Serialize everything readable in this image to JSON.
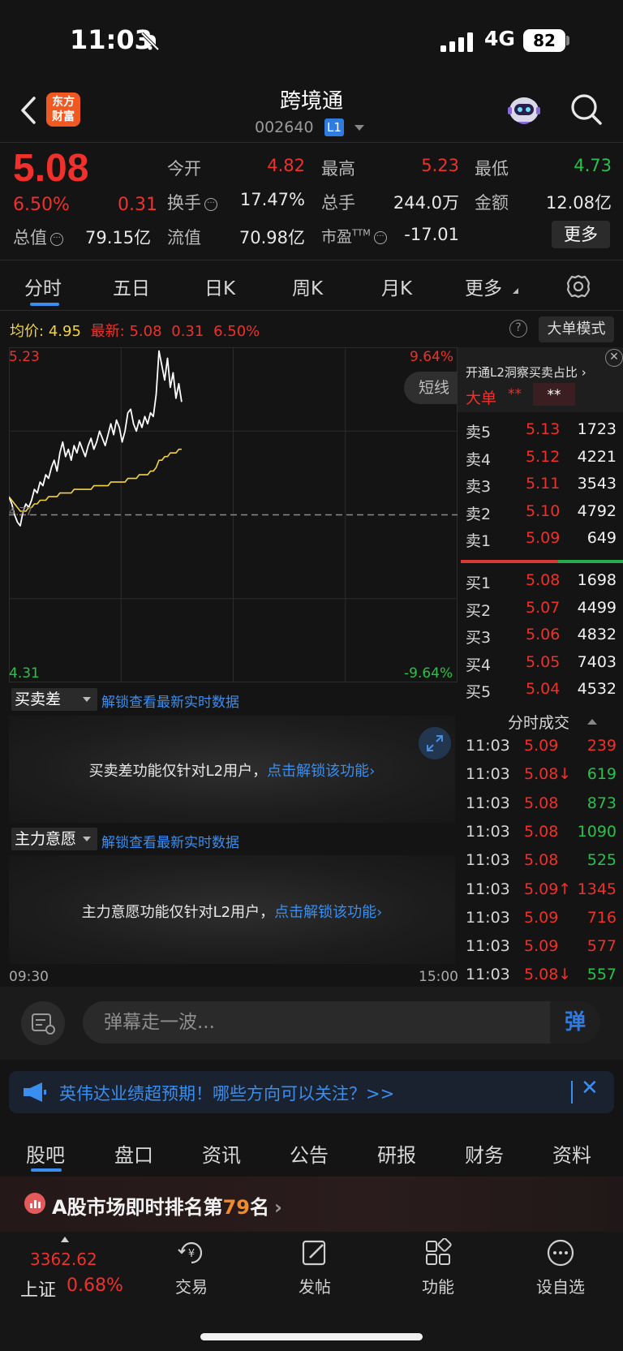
{
  "status_bar": {
    "time": "11:03",
    "network": "4G",
    "battery": "82"
  },
  "header": {
    "logo_text": "东方\n财富",
    "stock_name": "跨境通",
    "stock_code": "002640",
    "level": "L1"
  },
  "quote": {
    "price": "5.08",
    "change_pct": "6.50%",
    "change": "0.31",
    "open_label": "今开",
    "open": "4.82",
    "high_label": "最高",
    "high": "5.23",
    "low_label": "最低",
    "low": "4.73",
    "turnover_label": "换手",
    "turnover": "17.47%",
    "volume_label": "总手",
    "volume": "244.0万",
    "amount_label": "金额",
    "amount": "12.08亿",
    "mcap_label": "总值",
    "mcap": "79.15亿",
    "float_label": "流值",
    "float_mcap": "70.98亿",
    "pe_label": "市盈",
    "pe_sup": "TTM",
    "pe": "-17.01",
    "more_label": "更多"
  },
  "chart_tabs": [
    "分时",
    "五日",
    "日K",
    "周K",
    "月K",
    "更多"
  ],
  "legend": {
    "avg_label": "均价:",
    "avg": "4.95",
    "latest_label": "最新:",
    "latest": "5.08",
    "chg": "0.31",
    "pct": "6.50%",
    "help": "?",
    "big_order_mode": "大单模式"
  },
  "chart_data": {
    "type": "line",
    "y_axis_left": {
      "top": "5.23",
      "bottom": "4.31"
    },
    "y_axis_right": {
      "top": "9.64%",
      "bottom": "-9.64%"
    },
    "prev_close_label": "4.77",
    "ylim": [
      4.31,
      5.23
    ],
    "x_labels": [
      "09:30",
      "15:00"
    ],
    "series": [
      {
        "values": [
          4.82,
          4.8,
          4.77,
          4.75,
          4.74,
          4.78,
          4.8,
          4.79,
          4.81,
          4.84,
          4.83,
          4.86,
          4.85,
          4.88,
          4.87,
          4.9,
          4.92,
          4.89,
          4.94,
          4.97,
          4.93,
          4.95,
          4.92,
          4.96,
          4.94,
          4.97,
          4.95,
          4.93,
          4.96,
          4.98,
          4.95,
          4.97,
          5.0,
          4.98,
          4.96,
          4.99,
          5.02,
          4.99,
          5.03,
          5.01,
          4.97,
          5.0,
          5.05,
          5.06,
          5.02,
          5.0,
          5.03,
          5.01,
          5.04,
          5.02,
          5.05,
          5.04,
          5.1,
          5.22,
          5.18,
          5.14,
          5.2,
          5.12,
          5.16,
          5.09,
          5.13,
          5.08
        ]
      },
      {
        "values": [
          4.82,
          4.81,
          4.8,
          4.79,
          4.78,
          4.78,
          4.78,
          4.79,
          4.79,
          4.8,
          4.8,
          4.81,
          4.81,
          4.81,
          4.82,
          4.82,
          4.82,
          4.82,
          4.83,
          4.83,
          4.83,
          4.83,
          4.83,
          4.84,
          4.84,
          4.84,
          4.84,
          4.84,
          4.84,
          4.84,
          4.85,
          4.85,
          4.85,
          4.85,
          4.85,
          4.85,
          4.86,
          4.86,
          4.86,
          4.86,
          4.86,
          4.86,
          4.87,
          4.87,
          4.87,
          4.87,
          4.88,
          4.88,
          4.88,
          4.88,
          4.89,
          4.89,
          4.9,
          4.92,
          4.92,
          4.93,
          4.93,
          4.94,
          4.94,
          4.94,
          4.95,
          4.95
        ]
      }
    ],
    "colors": {
      "price": "#ffffff",
      "avg": "#f2d440"
    }
  },
  "short_line_btn": "短线",
  "indicators": [
    {
      "name": "买卖差",
      "link": "解锁查看最新实时数据",
      "locked_text": "买卖差功能仅针对L2用户，",
      "unlock_link": "点击解锁该功能"
    },
    {
      "name": "主力意愿",
      "link": "解锁查看最新实时数据",
      "locked_text": "主力意愿功能仅针对L2用户，",
      "unlock_link": "点击解锁该功能"
    }
  ],
  "time_axis": {
    "start": "09:30",
    "end": "15:00"
  },
  "order_book": {
    "promo": "开通L2洞察买卖占比",
    "big_order_label": "大单",
    "stars_1": "**",
    "stars_2": "**",
    "asks": [
      {
        "label": "卖5",
        "price": "5.13",
        "vol": "1723"
      },
      {
        "label": "卖4",
        "price": "5.12",
        "vol": "4221"
      },
      {
        "label": "卖3",
        "price": "5.11",
        "vol": "3543"
      },
      {
        "label": "卖2",
        "price": "5.10",
        "vol": "4792"
      },
      {
        "label": "卖1",
        "price": "5.09",
        "vol": "649"
      }
    ],
    "bids": [
      {
        "label": "买1",
        "price": "5.08",
        "vol": "1698"
      },
      {
        "label": "买2",
        "price": "5.07",
        "vol": "4499"
      },
      {
        "label": "买3",
        "price": "5.06",
        "vol": "4832"
      },
      {
        "label": "买4",
        "price": "5.05",
        "vol": "7403"
      },
      {
        "label": "买5",
        "price": "5.04",
        "vol": "4532"
      }
    ],
    "ticks_title": "分时成交",
    "ticks": [
      {
        "time": "11:03",
        "price": "5.09",
        "vol": "239",
        "dir": "red"
      },
      {
        "time": "11:03",
        "price": "5.08↓",
        "vol": "619",
        "dir": "green"
      },
      {
        "time": "11:03",
        "price": "5.08",
        "vol": "873",
        "dir": "green"
      },
      {
        "time": "11:03",
        "price": "5.08",
        "vol": "1090",
        "dir": "green"
      },
      {
        "time": "11:03",
        "price": "5.08",
        "vol": "525",
        "dir": "green"
      },
      {
        "time": "11:03",
        "price": "5.09↑",
        "vol": "1345",
        "dir": "red"
      },
      {
        "time": "11:03",
        "price": "5.09",
        "vol": "716",
        "dir": "red"
      },
      {
        "time": "11:03",
        "price": "5.09",
        "vol": "577",
        "dir": "red"
      },
      {
        "time": "11:03",
        "price": "5.08↓",
        "vol": "557",
        "dir": "green"
      }
    ]
  },
  "danmaku": {
    "placeholder": "弹幕走一波...",
    "send": "弹"
  },
  "news": {
    "text": "英伟达业绩超预期！哪些方向可以关注？>>",
    "close": "✕"
  },
  "bottom_tabs": [
    "股吧",
    "盘口",
    "资讯",
    "公告",
    "研报",
    "财务",
    "资料"
  ],
  "rank": {
    "prefix": "A股市场即时排名第",
    "rank": "79",
    "suffix": "名"
  },
  "index": {
    "value": "3362.62",
    "name": "上证",
    "pct": "0.68%"
  },
  "nav": [
    {
      "label": "交易",
      "icon": "trade-icon"
    },
    {
      "label": "发帖",
      "icon": "post-icon"
    },
    {
      "label": "功能",
      "icon": "apps-icon"
    },
    {
      "label": "设自选",
      "icon": "more-circle-icon"
    }
  ]
}
